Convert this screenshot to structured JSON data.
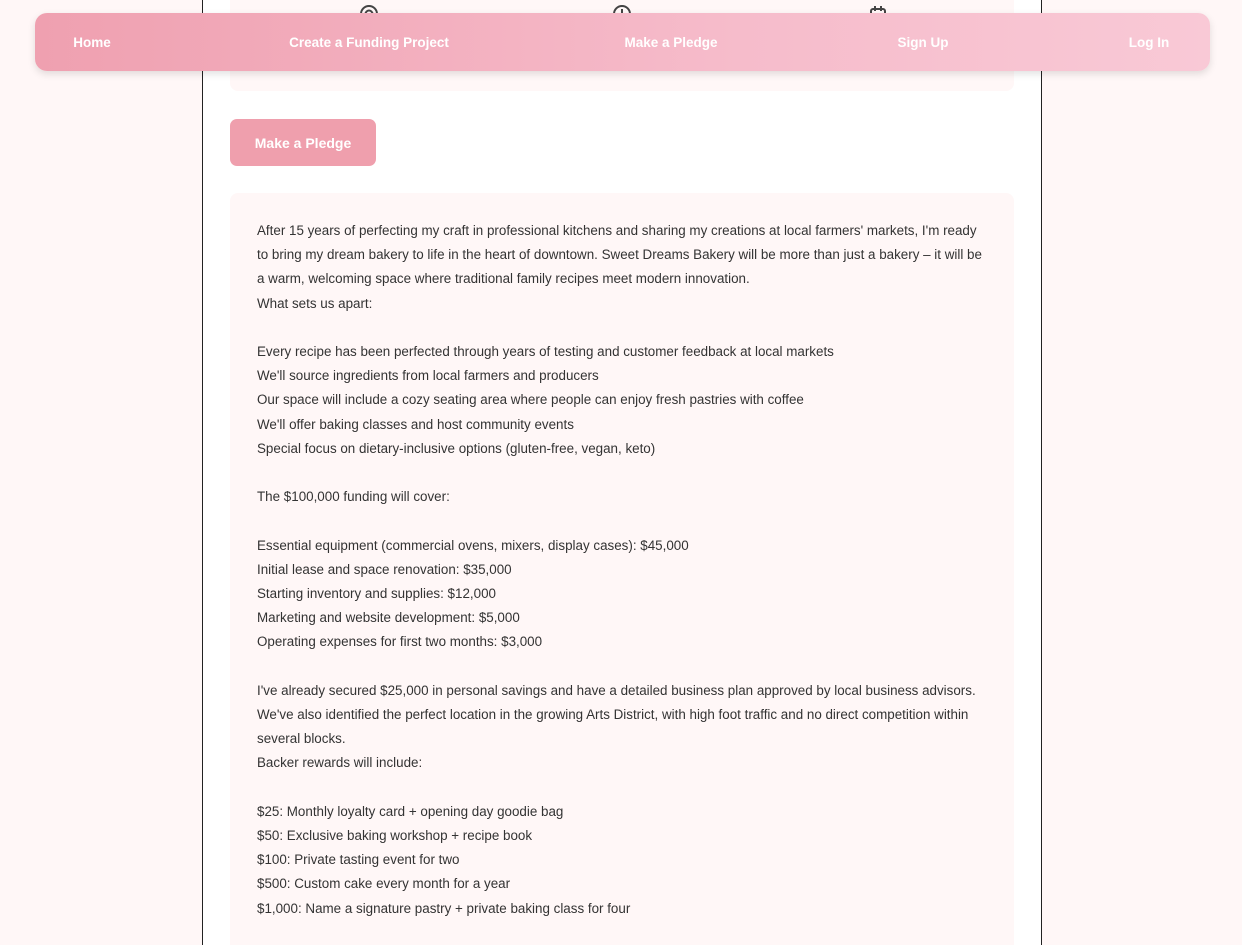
{
  "nav": {
    "home": "Home",
    "create": "Create a Funding Project",
    "pledge": "Make a Pledge",
    "signup": "Sign Up",
    "login": "Log In"
  },
  "stats_icons": [
    "target-icon",
    "dollar-icon",
    "calendar-icon"
  ],
  "pledge_button": "Make a Pledge",
  "description": {
    "intro": "After 15 years of perfecting my craft in professional kitchens and sharing my creations at local farmers' markets, I'm ready to bring my dream bakery to life in the heart of downtown. Sweet Dreams Bakery will be more than just a bakery – it will be a warm, welcoming space where traditional family recipes meet modern innovation.",
    "apart_heading": "What sets us apart:",
    "apart_items": [
      "Every recipe has been perfected through years of testing and customer feedback at local markets",
      "We'll source ingredients from local farmers and producers",
      "Our space will include a cozy seating area where people can enjoy fresh pastries with coffee",
      "We'll offer baking classes and host community events",
      "Special focus on dietary-inclusive options (gluten-free, vegan, keto)"
    ],
    "funding_heading": "The $100,000 funding will cover:",
    "funding_items": [
      "Essential equipment (commercial ovens, mixers, display cases): $45,000",
      "Initial lease and space renovation: $35,000",
      "Starting inventory and supplies: $12,000",
      "Marketing and website development: $5,000",
      "Operating expenses for first two months: $3,000"
    ],
    "savings": "I've already secured $25,000 in personal savings and have a detailed business plan approved by local business advisors. We've also identified the perfect location in the growing Arts District, with high foot traffic and no direct competition within several blocks.",
    "rewards_heading": "Backer rewards will include:",
    "rewards_items": [
      "$25: Monthly loyalty card + opening day goodie bag",
      "$50: Exclusive baking workshop + recipe book",
      "$100: Private tasting event for two",
      "$500: Custom cake every month for a year",
      "$1,000: Name a signature pastry + private baking class for four"
    ]
  },
  "colors": {
    "accent": "#ef9fad",
    "background": "#fff7f7",
    "text": "#333333"
  }
}
